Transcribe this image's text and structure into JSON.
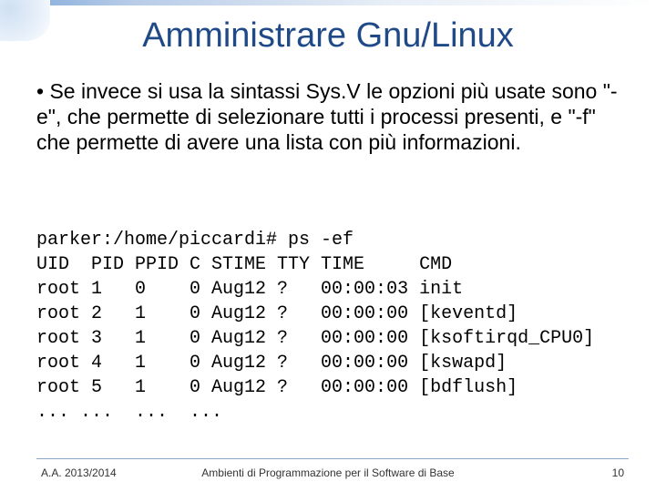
{
  "title": "Amministrare Gnu/Linux",
  "body": "• Se invece si usa la sintassi Sys.V le opzioni più usate sono \"-e\", che permette di selezionare tutti i processi presenti, e \"-f\" che permette di avere una lista con più informazioni.",
  "code": "parker:/home/piccardi# ps -ef\nUID  PID PPID C STIME TTY TIME     CMD\nroot 1   0    0 Aug12 ?   00:00:03 init\nroot 2   1    0 Aug12 ?   00:00:00 [keventd]\nroot 3   1    0 Aug12 ?   00:00:00 [ksoftirqd_CPU0]\nroot 4   1    0 Aug12 ?   00:00:00 [kswapd]\nroot 5   1    0 Aug12 ?   00:00:00 [bdflush]\n... ...  ...  ...",
  "footer": {
    "left": "A.A. 2013/2014",
    "center": "Ambienti di Programmazione per il Software di Base",
    "right": "10"
  }
}
